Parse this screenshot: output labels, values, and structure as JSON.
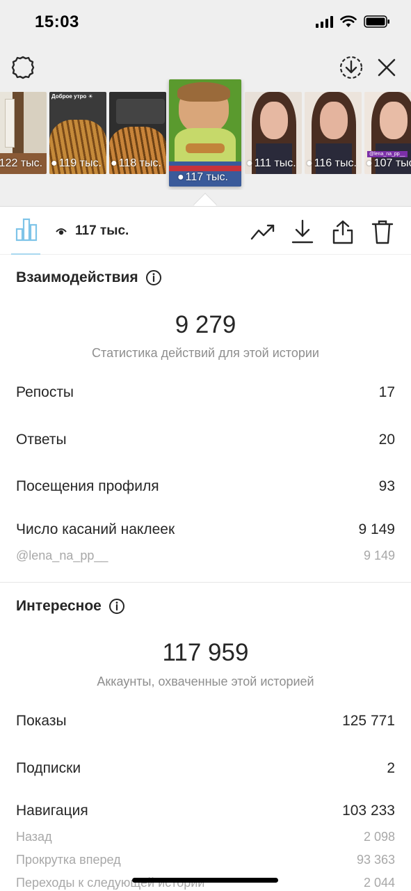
{
  "status_bar": {
    "time": "15:03"
  },
  "toolbar": {
    "settings_icon": "gear-icon",
    "download_icon": "download-circle-icon",
    "close_icon": "close-icon"
  },
  "stories": [
    {
      "views": "122 тыс.",
      "bg": "#8a6a4a",
      "caption": ""
    },
    {
      "views": "119 тыс.",
      "bg": "#b8782a",
      "caption": "Доброе утро ☀"
    },
    {
      "views": "118 тыс.",
      "bg": "#a86a2a",
      "caption": ""
    },
    {
      "views": "117 тыс.",
      "bg": "#6aa83a",
      "caption": "",
      "selected": true
    },
    {
      "views": "111 тыс.",
      "bg": "#c89070",
      "caption": ""
    },
    {
      "views": "116 тыс.",
      "bg": "#c4866a",
      "caption": ""
    },
    {
      "views": "107 тыс.",
      "bg": "#d09a7a",
      "caption": "",
      "tag": "@lena_na_pp__"
    }
  ],
  "tab_row": {
    "views_label": "117 тыс.",
    "icons": [
      "bar-chart-icon",
      "trend-icon",
      "download-icon",
      "share-icon",
      "trash-icon"
    ]
  },
  "interactions": {
    "title": "Взаимодействия",
    "total": "9 279",
    "caption": "Статистика действий для этой истории",
    "rows": [
      {
        "label": "Репосты",
        "value": "17"
      },
      {
        "label": "Ответы",
        "value": "20"
      },
      {
        "label": "Посещения профиля",
        "value": "93"
      },
      {
        "label": "Число касаний наклеек",
        "value": "9 149"
      }
    ],
    "sub_rows": [
      {
        "label": "@lena_na_pp__",
        "value": "9 149"
      }
    ]
  },
  "discovery": {
    "title": "Интересное",
    "total": "117 959",
    "caption": "Аккаунты, охваченные этой историей",
    "rows": [
      {
        "label": "Показы",
        "value": "125 771"
      },
      {
        "label": "Подписки",
        "value": "2"
      },
      {
        "label": "Навигация",
        "value": "103 233"
      }
    ],
    "sub_rows": [
      {
        "label": "Назад",
        "value": "2 098"
      },
      {
        "label": "Прокрутка вперед",
        "value": "93 363"
      },
      {
        "label": "Переходы к следующей истории",
        "value": "2 044"
      }
    ]
  },
  "colors": {
    "accent": "#a8d8ef",
    "text": "#262626",
    "muted": "#8e8e8e"
  }
}
